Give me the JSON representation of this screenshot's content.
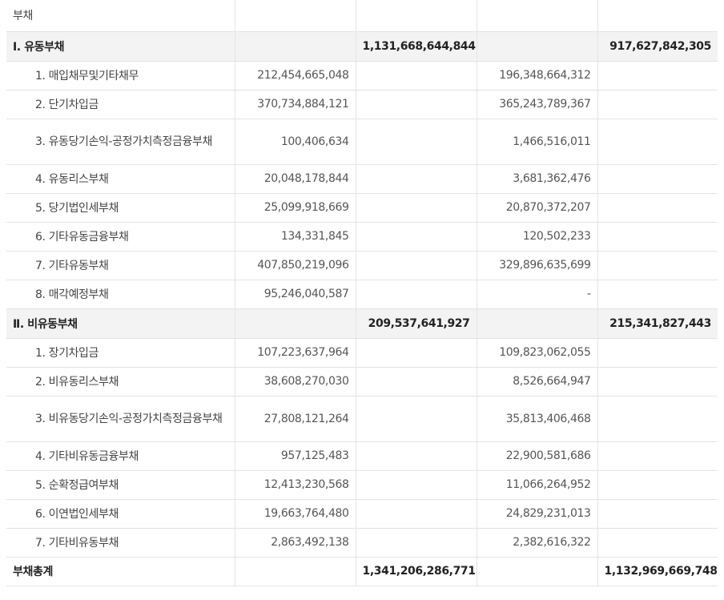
{
  "title_row": {
    "label": "부채"
  },
  "current": {
    "label": "Ⅰ. 유동부채",
    "total_prev": "1,131,668,644,844",
    "total_curr": "917,627,842,305",
    "items": [
      {
        "label": "1. 매입채무및기타채무",
        "a": "212,454,665,048",
        "b": "196,348,664,312"
      },
      {
        "label": "2. 단기차입금",
        "a": "370,734,884,121",
        "b": "365,243,789,367"
      },
      {
        "label": "3. 유동당기손익-공정가치측정금융부채",
        "a": "100,406,634",
        "b": "1,466,516,011"
      },
      {
        "label": "4. 유동리스부채",
        "a": "20,048,178,844",
        "b": "3,681,362,476"
      },
      {
        "label": "5. 당기법인세부채",
        "a": "25,099,918,669",
        "b": "20,870,372,207"
      },
      {
        "label": "6. 기타유동금융부채",
        "a": "134,331,845",
        "b": "120,502,233"
      },
      {
        "label": "7. 기타유동부채",
        "a": "407,850,219,096",
        "b": "329,896,635,699"
      },
      {
        "label": "8. 매각예정부채",
        "a": "95,246,040,587",
        "b": "-"
      }
    ]
  },
  "noncurrent": {
    "label": "Ⅱ. 비유동부채",
    "total_prev": "209,537,641,927",
    "total_curr": "215,341,827,443",
    "items": [
      {
        "label": "1. 장기차입금",
        "a": "107,223,637,964",
        "b": "109,823,062,055"
      },
      {
        "label": "2. 비유동리스부채",
        "a": "38,608,270,030",
        "b": "8,526,664,947"
      },
      {
        "label": "3. 비유동당기손익-공정가치측정금융부채",
        "a": "27,808,121,264",
        "b": "35,813,406,468"
      },
      {
        "label": "4. 기타비유동금융부채",
        "a": "957,125,483",
        "b": "22,900,581,686"
      },
      {
        "label": "5. 순확정급여부채",
        "a": "12,413,230,568",
        "b": "11,066,264,952"
      },
      {
        "label": "6. 이연법인세부채",
        "a": "19,663,764,480",
        "b": "24,829,231,013"
      },
      {
        "label": "7. 기타비유동부채",
        "a": "2,863,492,138",
        "b": "2,382,616,322"
      }
    ]
  },
  "total": {
    "label": "부채총계",
    "total_prev": "1,341,206,286,771",
    "total_curr": "1,132,969,669,748"
  }
}
